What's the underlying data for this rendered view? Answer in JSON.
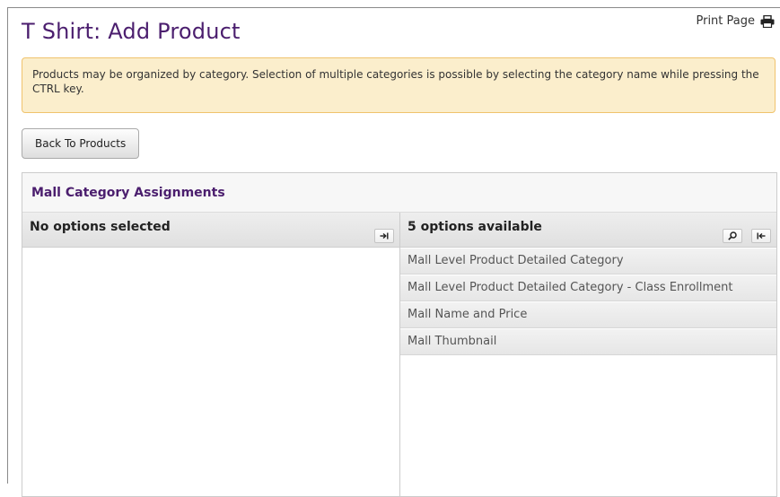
{
  "page": {
    "title": "T Shirt: Add Product",
    "print_label": "Print Page"
  },
  "alert": {
    "text": "Products may be organized by category. Selection of multiple categories is possible by selecting the category name while pressing the CTRL key."
  },
  "buttons": {
    "back_label": "Back To Products"
  },
  "assignments": {
    "title": "Mall Category Assignments",
    "selected_header": "No options selected",
    "available_header": "5 options available",
    "available_options": [
      "Mall Level Product Detailed Category",
      "Mall Level Product Detailed Category - Class Enrollment",
      "Mall Name and Price",
      "Mall Thumbnail"
    ]
  },
  "icons": {
    "print": "print-icon",
    "select_all": "arrow-right-to-bar-icon",
    "search": "search-icon",
    "remove_all": "arrow-left-to-bar-icon"
  },
  "colors": {
    "title": "#4b1e6e",
    "alert_background": "#fbeecc",
    "alert_border": "#f0c36d"
  }
}
